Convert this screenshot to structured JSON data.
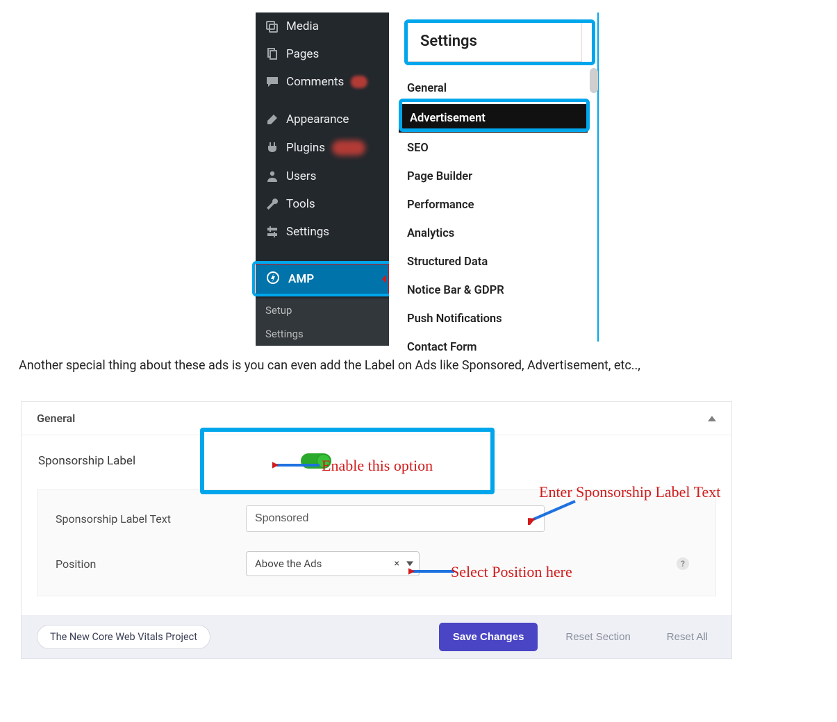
{
  "wp_sidebar": {
    "items": [
      {
        "label": "Media"
      },
      {
        "label": "Pages"
      },
      {
        "label": "Comments"
      },
      {
        "label": "Appearance"
      },
      {
        "label": "Plugins"
      },
      {
        "label": "Users"
      },
      {
        "label": "Tools"
      },
      {
        "label": "Settings"
      }
    ],
    "amp_label": "AMP",
    "amp_sub": [
      {
        "label": "Setup"
      },
      {
        "label": "Settings"
      }
    ]
  },
  "amp_tabs": {
    "header": "Settings",
    "items": [
      "General",
      "Advertisement",
      "SEO",
      "Page Builder",
      "Performance",
      "Analytics",
      "Structured Data",
      "Notice Bar & GDPR",
      "Push Notifications",
      "Contact Form"
    ],
    "active_index": 1
  },
  "paragraph": "Another special thing about these ads is you can even add the Label on Ads like Sponsored, Advertisement, etc..,",
  "general_panel": {
    "title": "General",
    "sponsorship_label": "Sponsorship Label",
    "sponsorship_toggle_on": true,
    "text_field": {
      "label": "Sponsorship Label Text",
      "value": "Sponsored"
    },
    "position_field": {
      "label": "Position",
      "value": "Above the Ads"
    }
  },
  "annotations": {
    "enable": "Enable this option",
    "enter_text": "Enter Sponsorship Label Text",
    "select_position": "Select Position here"
  },
  "actionbar": {
    "pill": "The New Core Web Vitals Project",
    "save": "Save Changes",
    "reset_section": "Reset Section",
    "reset_all": "Reset All"
  }
}
